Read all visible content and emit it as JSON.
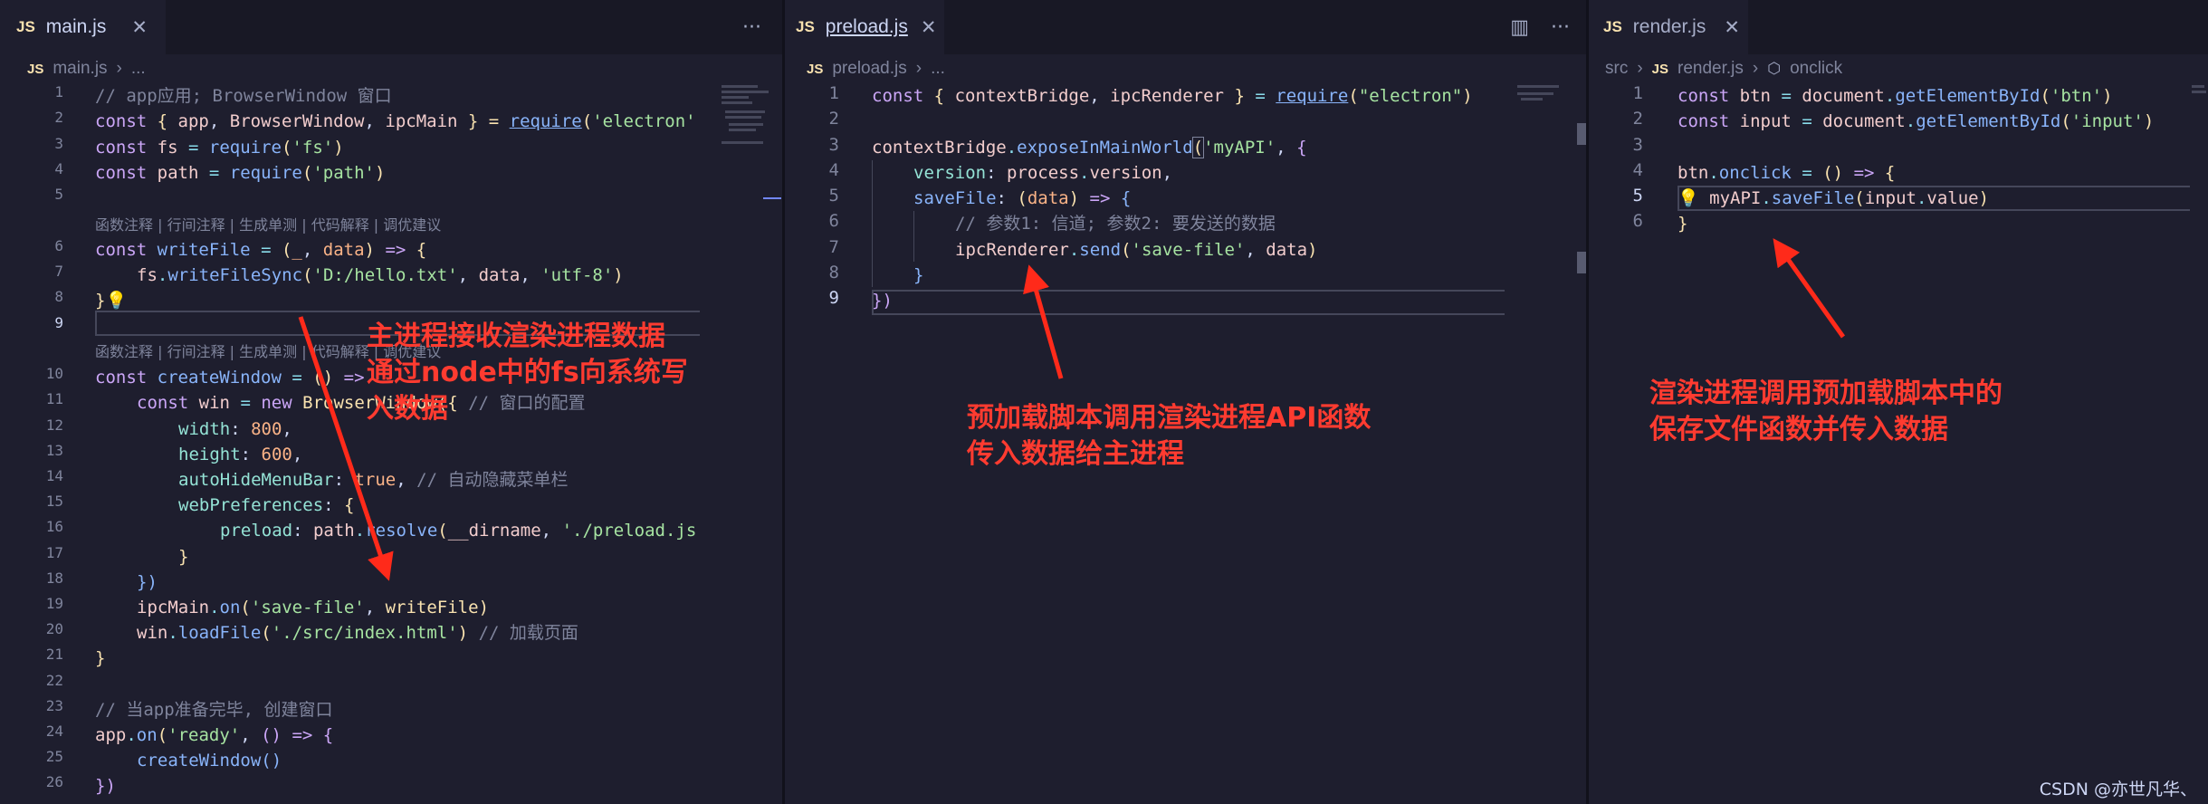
{
  "panes": [
    {
      "tab": {
        "icon": "JS",
        "name": "main.js",
        "close": "✕"
      },
      "actions": [
        "···"
      ],
      "breadcrumb": [
        "main.js",
        "..."
      ],
      "line_numbers": [
        "1",
        "2",
        "3",
        "4",
        "5",
        "6",
        "7",
        "8",
        "9",
        "10",
        "11",
        "12",
        "13",
        "14",
        "15",
        "16",
        "17",
        "18",
        "19",
        "20",
        "21",
        "22",
        "23",
        "24",
        "25",
        "26"
      ],
      "codelens": "函数注释 | 行间注释 | 生成单测 | 代码解释 | 调优建议"
    },
    {
      "tab": {
        "icon": "JS",
        "name": "preload.js",
        "close": "✕"
      },
      "actions": [
        "▥",
        "···"
      ],
      "breadcrumb": [
        "preload.js",
        "..."
      ],
      "line_numbers": [
        "1",
        "2",
        "3",
        "4",
        "5",
        "6",
        "7",
        "8",
        "9"
      ]
    },
    {
      "tab": {
        "icon": "JS",
        "name": "render.js",
        "close": "✕"
      },
      "breadcrumb": [
        "src",
        "render.js",
        "onclick"
      ],
      "line_numbers": [
        "1",
        "2",
        "3",
        "4",
        "5",
        "6"
      ]
    }
  ],
  "code": {
    "main": {
      "l1": "// app应用; BrowserWindow 窗口",
      "l2a": "const",
      "l2b": "{ ",
      "l2c": "app",
      "l2d": ", ",
      "l2e": "BrowserWindow",
      "l2f": ", ",
      "l2g": "ipcMain",
      "l2h": " } = ",
      "l2i": "require",
      "l2j": "(",
      "l2k": "'electron'",
      "l3a": "const",
      "l3b": "fs",
      "l3c": "require",
      "l3d": "'fs'",
      "l4a": "const",
      "l4b": "path",
      "l4c": "require",
      "l4d": "'path'",
      "l6a": "const",
      "l6b": "writeFile",
      "l6c": "_",
      "l6d": "data",
      "l7a": "fs",
      "l7b": "writeFileSync",
      "l7c": "'D:/hello.txt'",
      "l7d": "data",
      "l7e": "'utf-8'",
      "l8": "}",
      "l10a": "const",
      "l10b": "createWindow",
      "l10c": "=>",
      "l11a": "const",
      "l11b": "win",
      "l11c": "new",
      "l11d": "BrowserWindow",
      "l11e": "// 窗口的配置",
      "l12a": "width",
      "l12b": "800",
      "l13a": "height",
      "l13b": "600",
      "l14a": "autoHideMenuBar",
      "l14b": "true",
      "l14c": "// 自动隐藏菜单栏",
      "l15a": "webPreferences",
      "l16a": "preload",
      "l16b": "path",
      "l16c": "resolve",
      "l16d": "__dirname",
      "l16e": "'./preload.js",
      "l17": "}",
      "l18": "})",
      "l19a": "ipcMain",
      "l19b": "on",
      "l19c": "'save-file'",
      "l19d": "writeFile",
      "l20a": "win",
      "l20b": "loadFile",
      "l20c": "'./src/index.html'",
      "l20d": "// 加载页面",
      "l21": "}",
      "l23": "// 当app准备完毕, 创建窗口",
      "l24a": "app",
      "l24b": "on",
      "l24c": "'ready'",
      "l25": "createWindow",
      "l26": "})"
    },
    "preload": {
      "l1a": "const",
      "l1b": "contextBridge",
      "l1c": "ipcRenderer",
      "l1d": "require",
      "l1e": "\"electron\"",
      "l3a": "contextBridge",
      "l3b": "exposeInMainWorld",
      "l3c": "'myAPI'",
      "l4a": "version",
      "l4b": "process",
      "l4c": "version",
      "l5a": "saveFile",
      "l5b": "data",
      "l5c": "=>",
      "l6": "// 参数1: 信道; 参数2: 要发送的数据",
      "l7a": "ipcRenderer",
      "l7b": "send",
      "l7c": "'save-file'",
      "l7d": "data",
      "l8": "}",
      "l9": "})"
    },
    "render": {
      "l1a": "const",
      "l1b": "btn",
      "l1c": "document",
      "l1d": "getElementById",
      "l1e": "'btn'",
      "l2a": "const",
      "l2b": "input",
      "l2c": "document",
      "l2d": "getElementById",
      "l2e": "'input'",
      "l4a": "btn",
      "l4b": "onclick",
      "l4c": "=>",
      "l5a": "myAPI",
      "l5b": "saveFile",
      "l5c": "input",
      "l5d": "value",
      "l6": "}"
    }
  },
  "annotations": {
    "main": [
      "主进程接收渲染进程数据",
      "通过node中的fs向系统写",
      "入数据"
    ],
    "preload": [
      "预加载脚本调用渲染进程API函数",
      "传入数据给主进程"
    ],
    "render": [
      "渲染进程调用预加载脚本中的",
      "保存文件函数并传入数据"
    ]
  },
  "watermark": "CSDN @亦世凡华、",
  "colors": {
    "background": "#1e1e2e",
    "annotation": "#ff3b30",
    "keyword": "#cba6f7",
    "string": "#a6e3a1",
    "function": "#89b4fa"
  }
}
